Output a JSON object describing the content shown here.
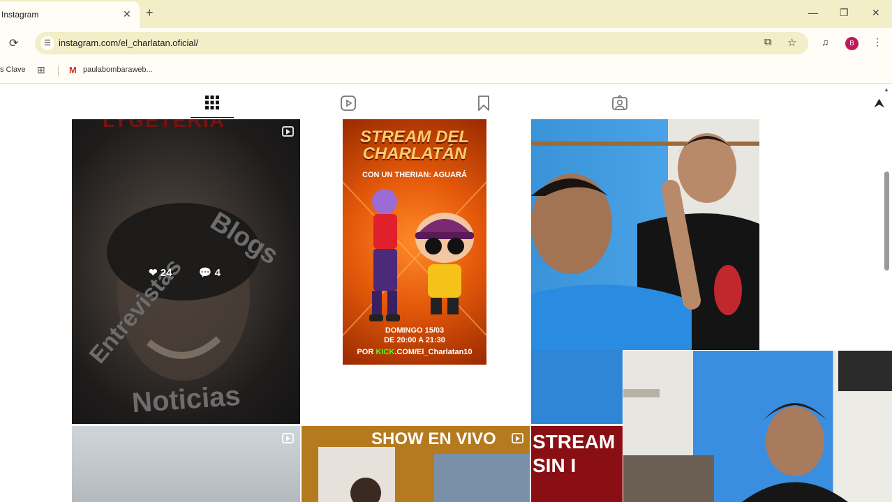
{
  "browser": {
    "tab_title": "Instagram",
    "tab_close": "✕",
    "new_tab": "+",
    "url": "instagram.com/el_charlatan.oficial/",
    "profile_initial": "B",
    "bookmarks": [
      {
        "label": "s Clave"
      },
      {
        "label": "paulabombaraweb..."
      }
    ],
    "colors": {
      "chrome_bg": "#f1eec8",
      "toolbar_bg": "#fffdf5",
      "profile": "#c2185b"
    }
  },
  "profile_tabs": [
    {
      "icon": "grid-icon",
      "active": true
    },
    {
      "icon": "reels-icon",
      "active": false
    },
    {
      "icon": "saved-icon",
      "active": false
    },
    {
      "icon": "tagged-icon",
      "active": false
    }
  ],
  "posts": [
    {
      "id": "post-1",
      "type": "reel",
      "overlay_words": [
        "Blogs",
        "Entrevistas",
        "Noticias"
      ],
      "title_fragment": "LYGETERIA",
      "likes": "24",
      "comments": "4"
    },
    {
      "id": "post-2",
      "title": "STREAM DEL CHARLATÁN",
      "subtitle": "CON UN THERIAN: AGUARÁ",
      "date": "DOMINGO 15/03",
      "time": "DE 20:00 A 21:30",
      "kick_prefix": "POR ",
      "kick_brand": "KICK",
      "kick_path": ".COM/El_Charlatan10"
    },
    {
      "id": "post-3",
      "type": "photo"
    },
    {
      "id": "post-4",
      "type": "reel"
    },
    {
      "id": "post-5",
      "type": "reel",
      "title": "SHOW EN VIVO"
    },
    {
      "id": "post-6",
      "title": "STREAM SIN I"
    }
  ]
}
